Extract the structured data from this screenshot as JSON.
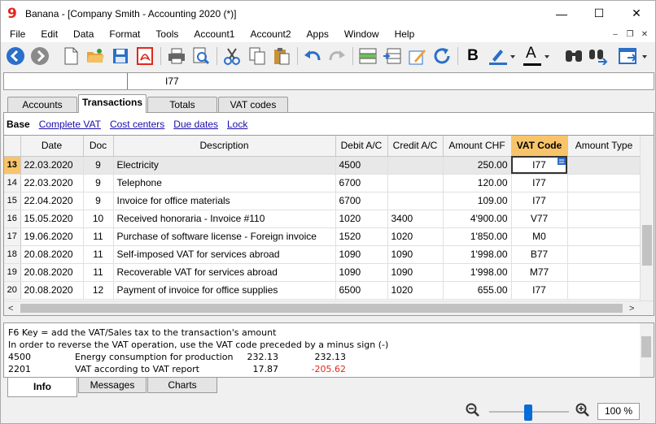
{
  "window": {
    "title": "Banana - [Company Smith - Accounting 2020 (*)]",
    "logo_glyph": "9",
    "minimize_glyph": "—",
    "maximize_glyph": "☐",
    "close_glyph": "✕"
  },
  "menu": {
    "items": [
      "File",
      "Edit",
      "Data",
      "Format",
      "Tools",
      "Account1",
      "Account2",
      "Apps",
      "Window",
      "Help"
    ],
    "mdi_minimize": "–",
    "mdi_restore": "❐",
    "mdi_close": "✕"
  },
  "toolbar": {
    "icons": [
      "back-icon",
      "forward-icon",
      "new-file-icon",
      "open-folder-icon",
      "save-icon",
      "pdf-icon",
      "print-icon",
      "print-preview-icon",
      "cut-icon",
      "copy-icon",
      "paste-icon",
      "undo-icon",
      "redo-icon",
      "insert-row-icon",
      "add-rows-icon",
      "edit-pencil-icon",
      "recalculate-icon",
      "bold-icon",
      "highlight-icon",
      "font-color-icon",
      "find-icon",
      "find-replace-icon",
      "view-window-icon"
    ],
    "bold_glyph": "B",
    "font_color_glyph": "A",
    "accent_blue": "#2a6fc9",
    "accent_red": "#e0281c",
    "accent_orange": "#e8a23a"
  },
  "cell_editor": {
    "reference": "",
    "value": "I77"
  },
  "tabs": [
    {
      "label": "Accounts",
      "active": false
    },
    {
      "label": "Transactions",
      "active": true
    },
    {
      "label": "Totals",
      "active": false
    },
    {
      "label": "VAT codes",
      "active": false
    }
  ],
  "views": [
    {
      "label": "Base",
      "active": true
    },
    {
      "label": "Complete VAT",
      "active": false
    },
    {
      "label": "Cost centers",
      "active": false
    },
    {
      "label": "Due dates",
      "active": false
    },
    {
      "label": "Lock",
      "active": false
    }
  ],
  "grid": {
    "columns": [
      "Date",
      "Doc",
      "Description",
      "Debit A/C",
      "Credit A/C",
      "Amount CHF",
      "VAT Code",
      "Amount Type"
    ],
    "rows": [
      {
        "num": "13",
        "date": "22.03.2020",
        "doc": "9",
        "desc": "Electricity",
        "debit": "4500",
        "credit": "",
        "amount": "250.00",
        "vat": "I77",
        "type": "",
        "current": true
      },
      {
        "num": "14",
        "date": "22.03.2020",
        "doc": "9",
        "desc": "Telephone",
        "debit": "6700",
        "credit": "",
        "amount": "120.00",
        "vat": "I77",
        "type": ""
      },
      {
        "num": "15",
        "date": "22.04.2020",
        "doc": "9",
        "desc": "Invoice for office materials",
        "debit": "6700",
        "credit": "",
        "amount": "109.00",
        "vat": "I77",
        "type": ""
      },
      {
        "num": "16",
        "date": "15.05.2020",
        "doc": "10",
        "desc": "Received honoraria - Invoice #110",
        "debit": "1020",
        "credit": "3400",
        "amount": "4'900.00",
        "vat": "V77",
        "type": ""
      },
      {
        "num": "17",
        "date": "19.06.2020",
        "doc": "11",
        "desc": "Purchase of software license - Foreign invoice",
        "debit": "1520",
        "credit": "1020",
        "amount": "1'850.00",
        "vat": "M0",
        "type": ""
      },
      {
        "num": "18",
        "date": "20.08.2020",
        "doc": "11",
        "desc": "Self-imposed VAT for services abroad",
        "debit": "1090",
        "credit": "1090",
        "amount": "1'998.00",
        "vat": "B77",
        "type": ""
      },
      {
        "num": "19",
        "date": "20.08.2020",
        "doc": "11",
        "desc": "Recoverable VAT for services abroad",
        "debit": "1090",
        "credit": "1090",
        "amount": "1'998.00",
        "vat": "M77",
        "type": ""
      },
      {
        "num": "20",
        "date": "20.08.2020",
        "doc": "12",
        "desc": "Payment of invoice for office supplies",
        "debit": "6500",
        "credit": "1020",
        "amount": "655.00",
        "vat": "I77",
        "type": ""
      }
    ],
    "scroll_left_glyph": "<",
    "scroll_right_glyph": ">"
  },
  "info": {
    "line1": "F6 Key = add the VAT/Sales tax to the transaction's amount",
    "line2": "In order to reverse the VAT operation, use the VAT code preceded by a minus sign (-)",
    "entries": [
      {
        "account": "4500",
        "label": "Energy consumption for production",
        "amount": "232.13",
        "balance": "232.13",
        "negative": false
      },
      {
        "account": "2201",
        "label": "VAT according to VAT report",
        "amount": "17.87",
        "balance": "-205.62",
        "negative": true
      }
    ],
    "negative_color": "#e0281c"
  },
  "bottom_tabs": [
    {
      "label": "Info",
      "active": true
    },
    {
      "label": "Messages",
      "active": false
    },
    {
      "label": "Charts",
      "active": false
    }
  ],
  "status": {
    "zoom": "100 %",
    "zoom_level_percent": 100
  }
}
